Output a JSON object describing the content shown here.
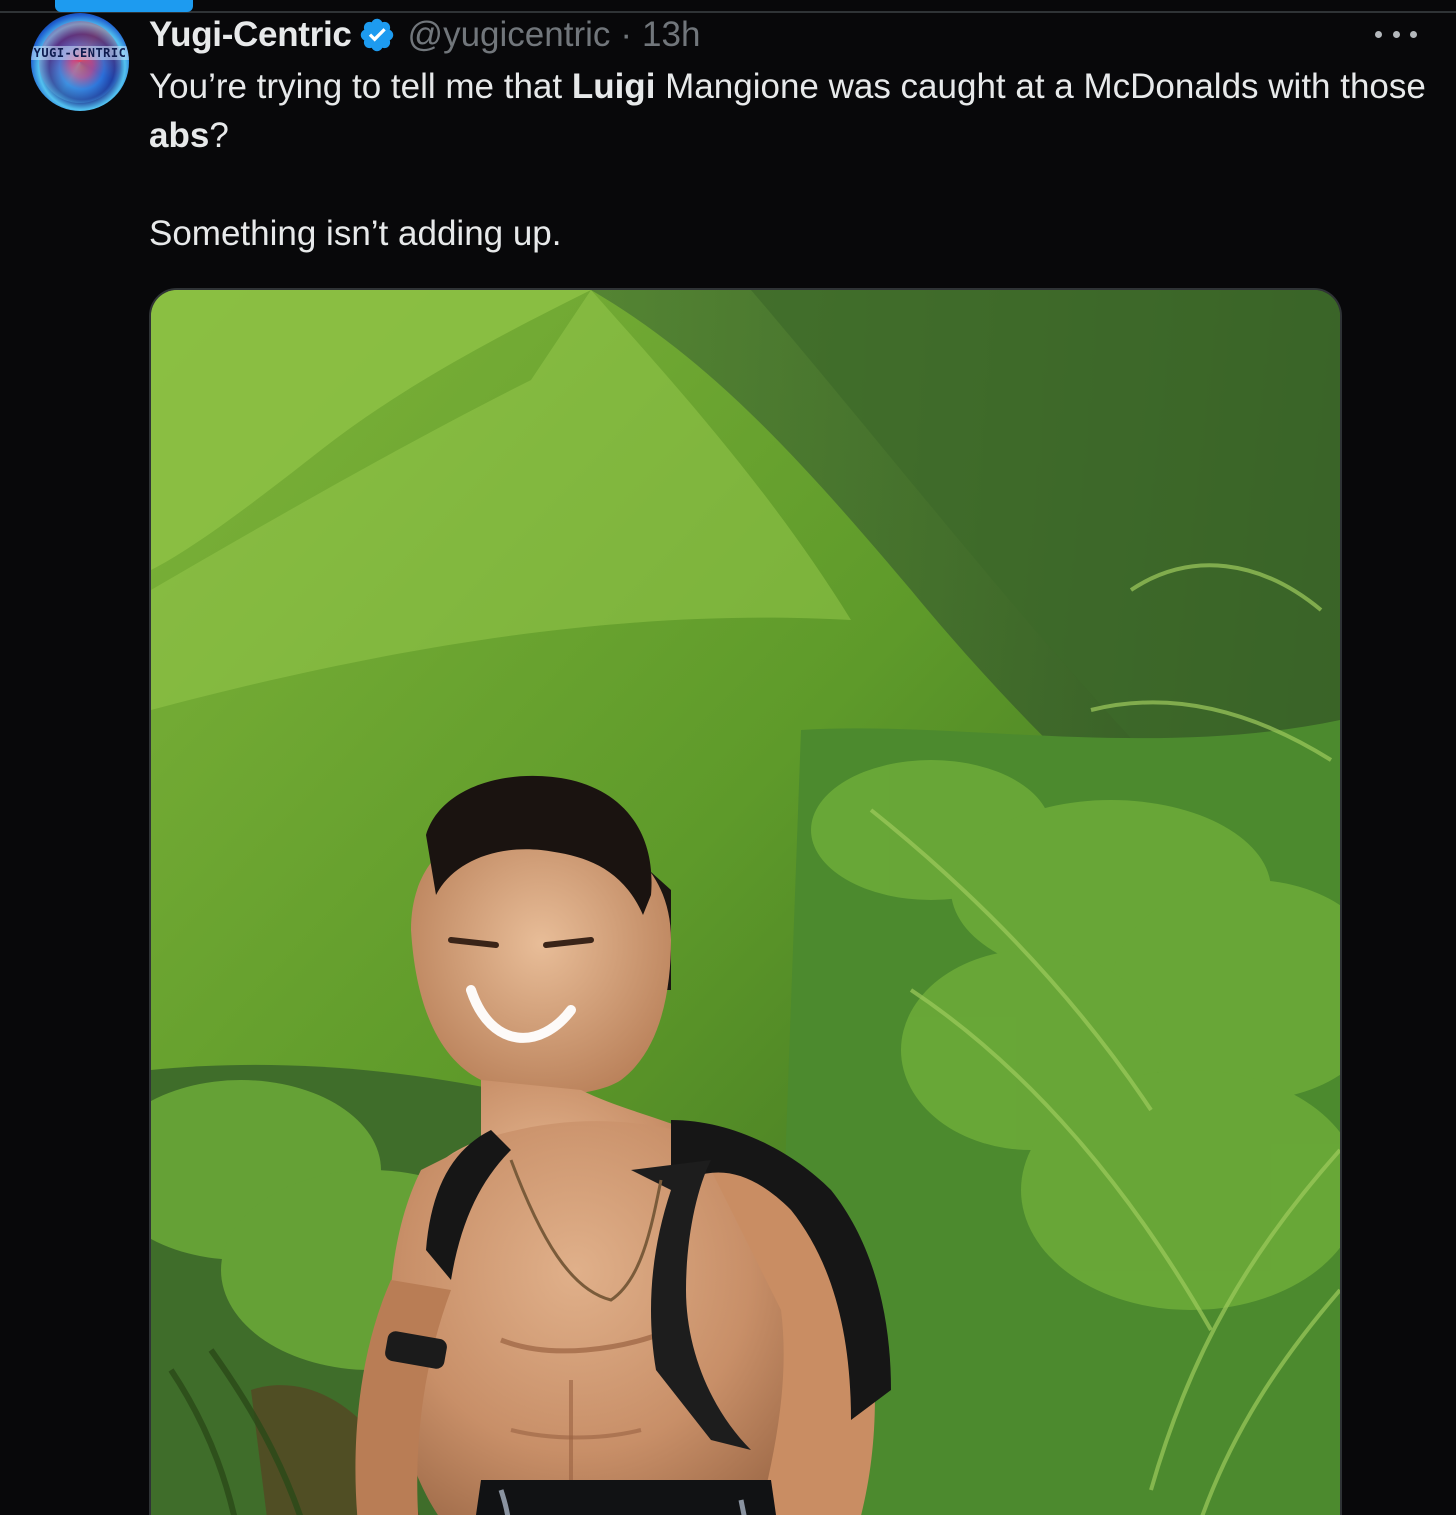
{
  "tweet": {
    "author": {
      "display_name": "Yugi-Centric",
      "handle": "@yugicentric",
      "verified": true,
      "avatar_text": "YUGI-CENTRIC"
    },
    "separator": "·",
    "timestamp": "13h",
    "more_icon": "more-horizontal-icon",
    "text": {
      "line1_pre": "You’re trying to tell me that ",
      "line1_bold1": "Luigi",
      "line1_mid": " Mangione was caught at a McDonalds with those ",
      "line1_bold2": "abs",
      "line1_post": "?",
      "line2": "Something isn’t adding up."
    },
    "media": {
      "type": "photo"
    }
  },
  "colors": {
    "background": "#08080a",
    "text": "#e7e9ea",
    "secondary_text": "#71767b",
    "verified_blue": "#1d9bf0"
  }
}
